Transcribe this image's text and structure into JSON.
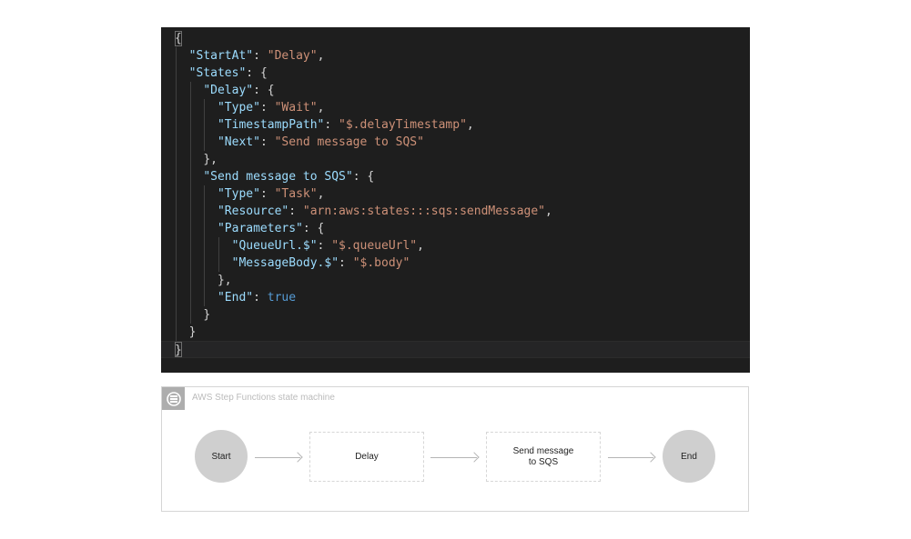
{
  "code": {
    "lines": [
      "{",
      "  \"StartAt\": \"Delay\",",
      "  \"States\": {",
      "    \"Delay\": {",
      "      \"Type\": \"Wait\",",
      "      \"TimestampPath\": \"$.delayTimestamp\",",
      "      \"Next\": \"Send message to SQS\"",
      "    },",
      "    \"Send message to SQS\": {",
      "      \"Type\": \"Task\",",
      "      \"Resource\": \"arn:aws:states:::sqs:sendMessage\",",
      "      \"Parameters\": {",
      "        \"QueueUrl.$\": \"$.queueUrl\",",
      "        \"MessageBody.$\": \"$.body\"",
      "      },",
      "      \"End\": true",
      "    }",
      "  }",
      "}"
    ],
    "colors": {
      "background": "#1e1e1e",
      "key": "#9cdcfe",
      "string": "#ce9178",
      "boolean": "#569cd6",
      "punctuation": "#d4d4d4"
    }
  },
  "state_machine": {
    "title": "AWS Step Functions state machine",
    "icon": "step-functions-icon",
    "nodes": {
      "start": "Start",
      "delay": "Delay",
      "send_line1": "Send message",
      "send_line2": "to SQS",
      "end": "End"
    }
  }
}
